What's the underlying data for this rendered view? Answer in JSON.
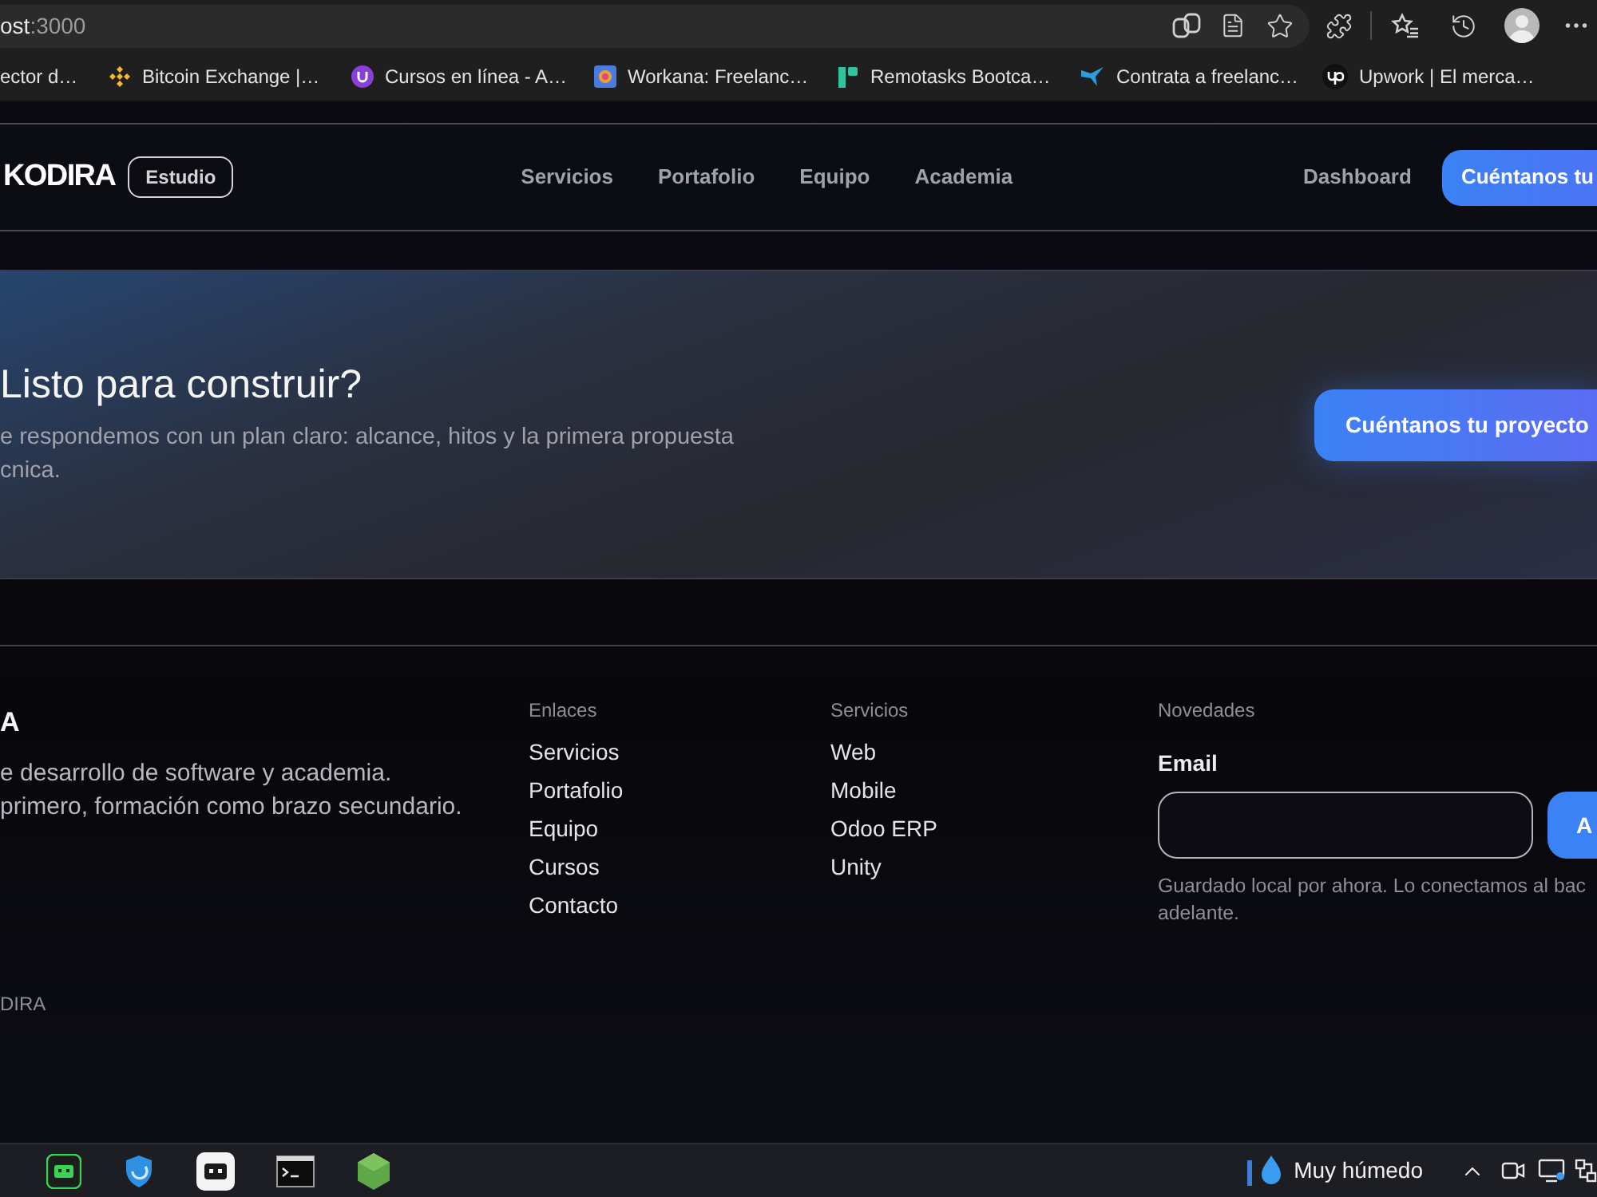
{
  "browser": {
    "url_host": "ost",
    "url_port": ":3000",
    "bookmarks": [
      {
        "label": "ector d…"
      },
      {
        "label": "Bitcoin Exchange |…"
      },
      {
        "label": "Cursos en línea - A…"
      },
      {
        "label": "Workana: Freelanc…"
      },
      {
        "label": "Remotasks Bootca…"
      },
      {
        "label": "Contrata a freelanc…"
      },
      {
        "label": "Upwork | El merca…"
      }
    ]
  },
  "navbar": {
    "logo": "KODIRA",
    "badge": "Estudio",
    "links": [
      {
        "label": "Servicios"
      },
      {
        "label": "Portafolio"
      },
      {
        "label": "Equipo"
      },
      {
        "label": "Academia"
      }
    ],
    "dashboard": "Dashboard",
    "cta": "Cuéntanos tu"
  },
  "cta_section": {
    "title": "Listo para construir?",
    "text_lines": [
      "e respondemos con un plan claro: alcance, hitos y la primera propuesta",
      "cnica."
    ],
    "button": "Cuéntanos tu proyecto"
  },
  "footer": {
    "brand": "A",
    "description_lines": [
      "e desarrollo de software y academia.",
      "primero, formación como brazo secundario."
    ],
    "columns": [
      {
        "heading": "Enlaces",
        "links": [
          "Servicios",
          "Portafolio",
          "Equipo",
          "Cursos",
          "Contacto"
        ]
      },
      {
        "heading": "Servicios",
        "links": [
          "Web",
          "Mobile",
          "Odoo ERP",
          "Unity"
        ]
      }
    ],
    "newsletter": {
      "heading": "Novedades",
      "label": "Email",
      "button": "A",
      "hint_lines": [
        "Guardado local por ahora. Lo conectamos al bac",
        "adelante."
      ]
    },
    "copyright": "DIRA"
  },
  "taskbar": {
    "weather": "Muy húmedo"
  }
}
